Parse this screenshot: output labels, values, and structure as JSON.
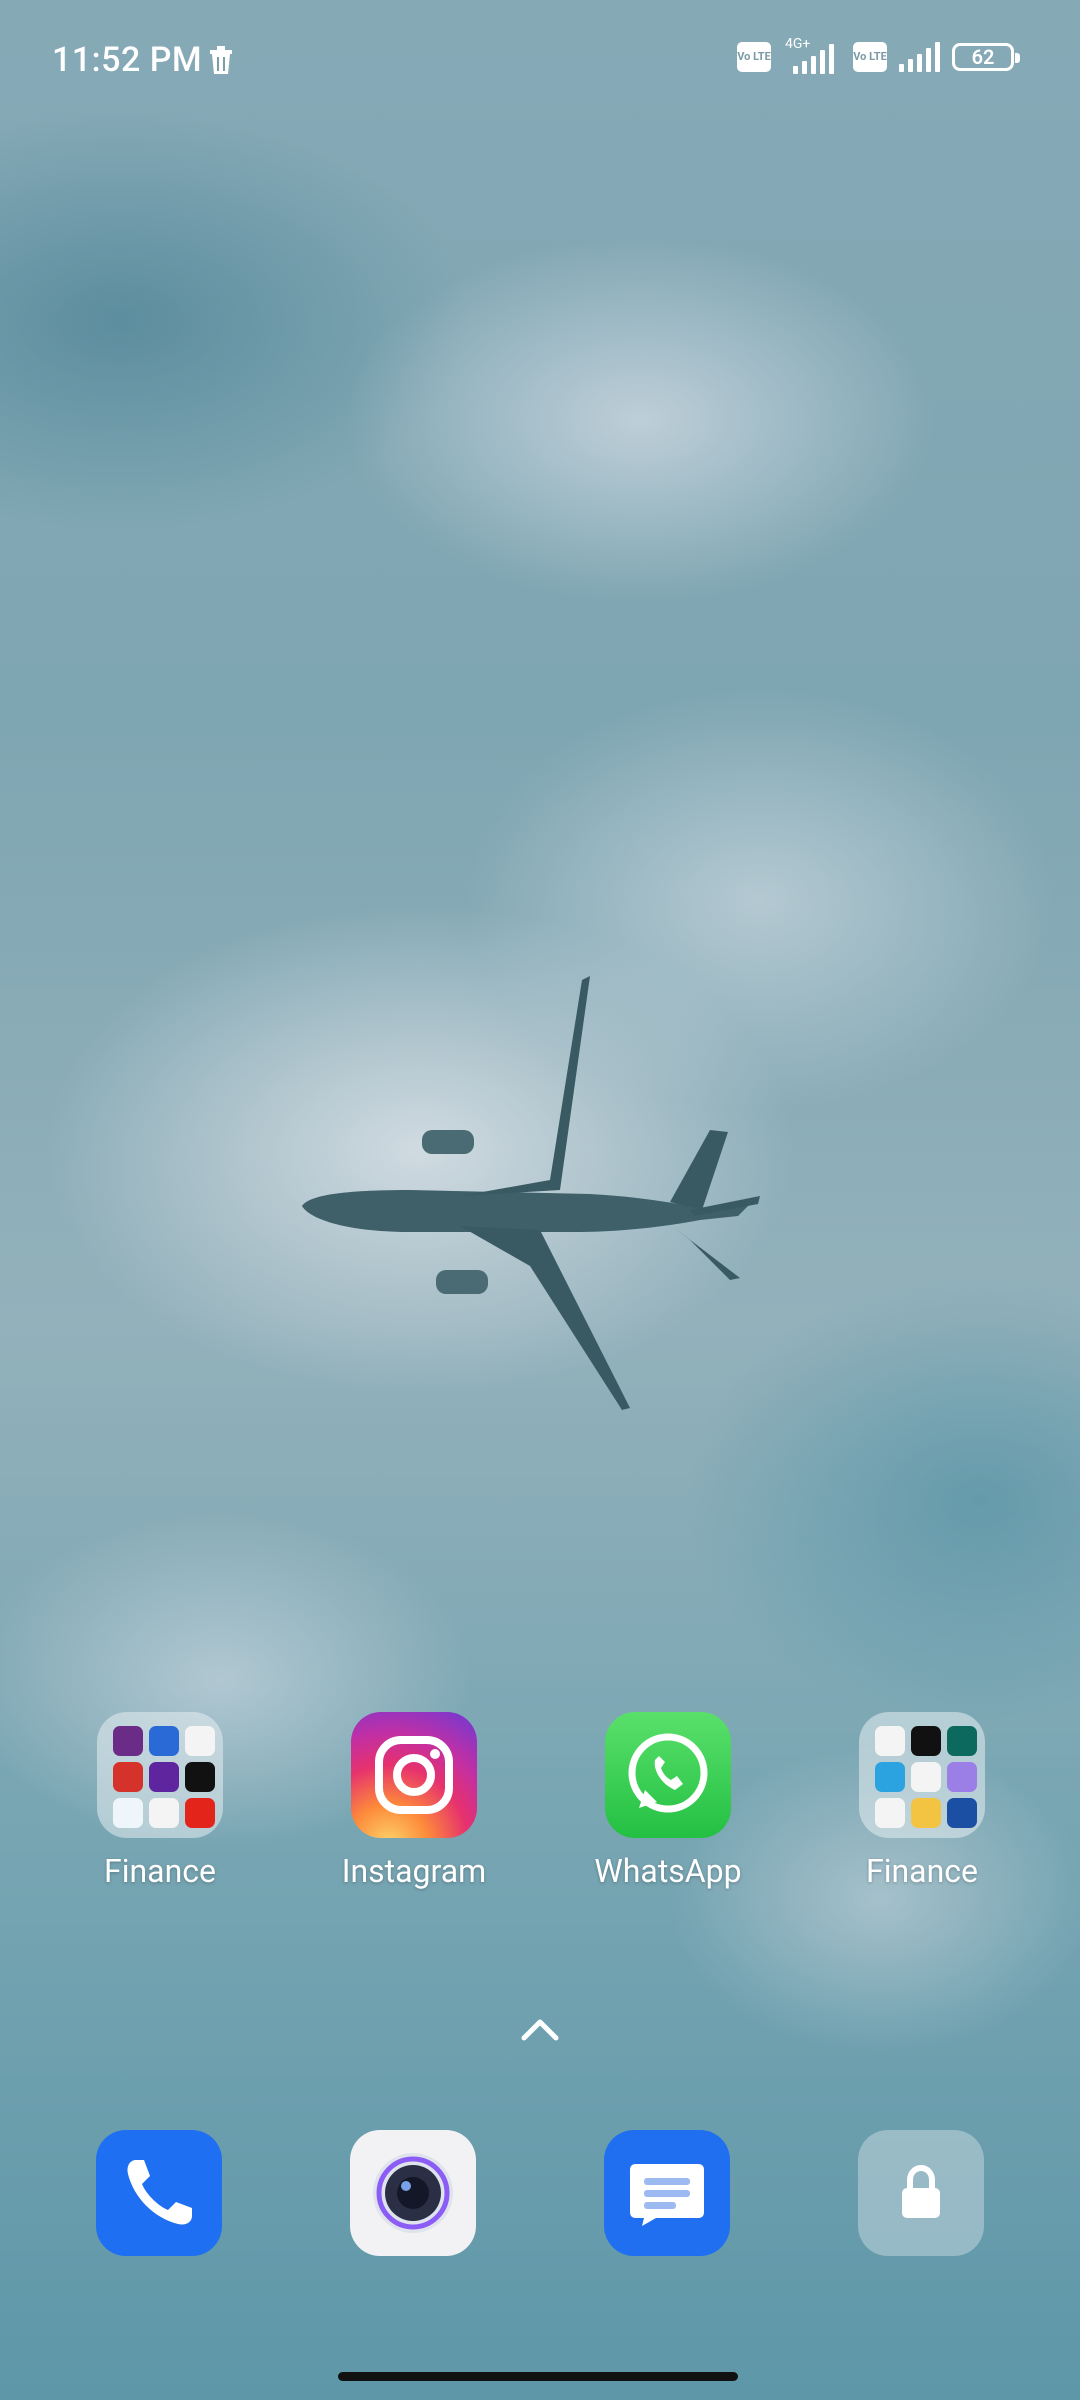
{
  "status_bar": {
    "time": "11:52 PM",
    "network_type": "4G+",
    "sim1_badge": "Vo LTE",
    "sim2_badge": "Vo LTE",
    "battery_level": "62"
  },
  "home_apps": [
    {
      "label": "Finance",
      "type": "folder"
    },
    {
      "label": "Instagram",
      "type": "app"
    },
    {
      "label": "WhatsApp",
      "type": "app"
    },
    {
      "label": "Finance",
      "type": "folder"
    }
  ],
  "dock": [
    {
      "name": "Phone"
    },
    {
      "name": "Camera"
    },
    {
      "name": "Messages"
    },
    {
      "name": "Locked app"
    }
  ],
  "colors": {
    "phone": "#1e6ff1",
    "messages": "#1f6ff0",
    "whatsapp": "#25c244"
  }
}
